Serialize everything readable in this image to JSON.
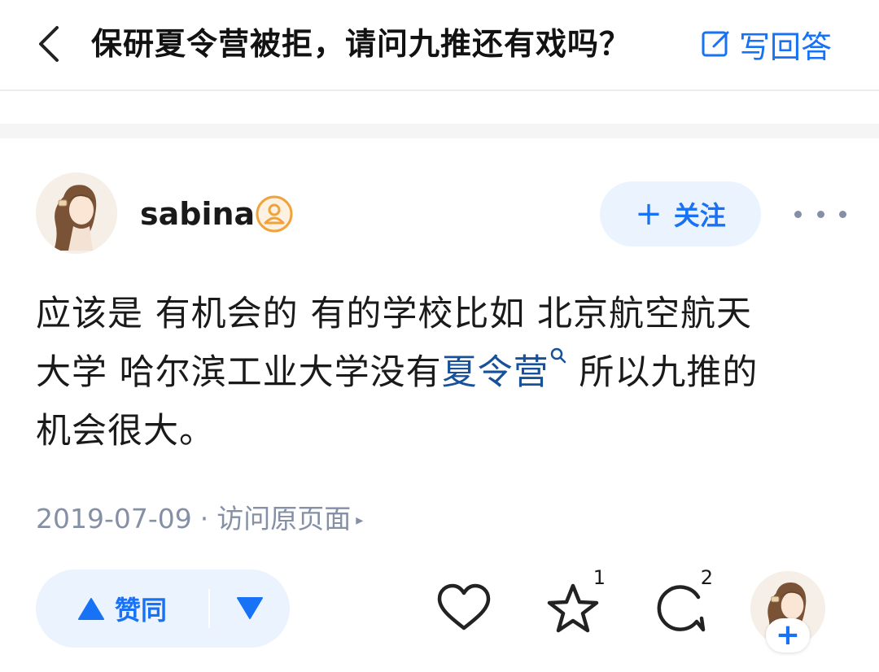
{
  "header": {
    "back_icon": "chevron-left-icon",
    "question_title": "保研夏令营被拒，请问九推还有戏吗？",
    "write_answer_label": "写回答",
    "write_answer_icon": "edit-icon"
  },
  "author": {
    "name": "sabina",
    "badge_icon": "user-badge-icon",
    "avatar_icon": "avatar-illustration"
  },
  "follow": {
    "plus": "+",
    "label": "关注"
  },
  "more_icon": "more-dots-icon",
  "answer": {
    "line1": "应该是 有机会的 有的学校比如 北京航空航天",
    "line2_before": "大学 哈尔滨工业大学没有",
    "keyword": "夏令营",
    "line2_after": " 所以九推的",
    "line3": "机会很大。"
  },
  "meta": {
    "date": "2019-07-09",
    "separator": "·",
    "visit_label": "访问原页面",
    "visit_arrow": "▸"
  },
  "actions": {
    "upvote_label": "赞同",
    "like_count": "",
    "star_count": "1",
    "comment_count": "2",
    "follow_plus": "+"
  },
  "colors": {
    "accent": "#1772f6",
    "accent_bg": "#ebf3ff",
    "link": "#175199",
    "meta_gray": "#8590a6",
    "badge_orange": "#f0a23b"
  }
}
